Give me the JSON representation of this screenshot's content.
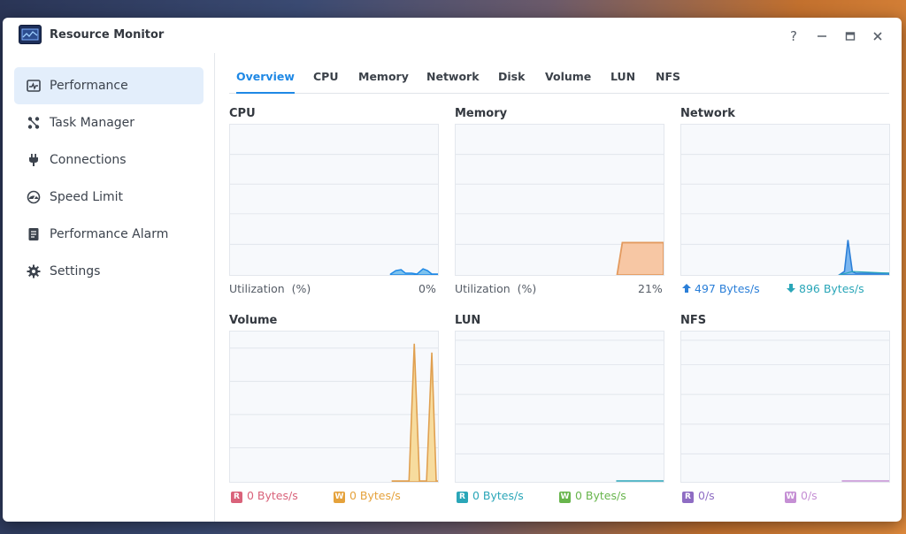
{
  "window": {
    "title": "Resource Monitor",
    "controls": {
      "help": "?",
      "minimize": "—",
      "maximize": "▭",
      "close": "✕"
    }
  },
  "sidebar": {
    "items": [
      {
        "label": "Performance",
        "icon": "performance-icon",
        "active": true
      },
      {
        "label": "Task Manager",
        "icon": "task-manager-icon",
        "active": false
      },
      {
        "label": "Connections",
        "icon": "plug-icon",
        "active": false
      },
      {
        "label": "Speed Limit",
        "icon": "gauge-icon",
        "active": false
      },
      {
        "label": "Performance Alarm",
        "icon": "alarm-document-icon",
        "active": false
      },
      {
        "label": "Settings",
        "icon": "gear-icon",
        "active": false
      }
    ]
  },
  "tabs": [
    "Overview",
    "CPU",
    "Memory",
    "Network",
    "Disk",
    "Volume",
    "LUN",
    "NFS"
  ],
  "active_tab": "Overview",
  "panels": {
    "cpu": {
      "title": "CPU",
      "label": "Utilization",
      "unit": "(%)",
      "value": "0%"
    },
    "memory": {
      "title": "Memory",
      "label": "Utilization",
      "unit": "(%)",
      "value": "21%"
    },
    "network": {
      "title": "Network",
      "up": "497 Bytes/s",
      "down": "896 Bytes/s"
    },
    "volume": {
      "title": "Volume",
      "read_badge": "R",
      "read": "0 Bytes/s",
      "write_badge": "W",
      "write": "0 Bytes/s"
    },
    "lun": {
      "title": "LUN",
      "read_badge": "R",
      "read": "0 Bytes/s",
      "write_badge": "W",
      "write": "0 Bytes/s"
    },
    "nfs": {
      "title": "NFS",
      "read_badge": "R",
      "read": "0/s",
      "write_badge": "W",
      "write": "0/s"
    }
  },
  "colors": {
    "accent": "#1e88e5",
    "cpu": "#1e88e5",
    "memory": "#e8a06a",
    "network": "#2b7fd8",
    "volume": "#e0a050",
    "read": "#d9627a",
    "write": "#e5a23c",
    "lun_read": "#2aa6b8",
    "lun_write": "#68b54c",
    "nfs_read": "#8e6cc3",
    "nfs_write": "#c58fd4"
  }
}
